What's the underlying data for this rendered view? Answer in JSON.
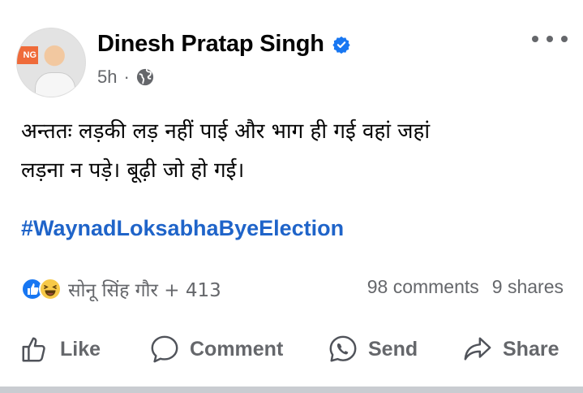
{
  "post": {
    "author": "Dinesh Pratap Singh",
    "time": "5h",
    "separator": "·",
    "avatar_flag_text": "NG",
    "body_lines": [
      "अन्ततः लड़की लड़ नहीं पाई और भाग ही गई वहां जहां",
      "लड़ना न पड़े। बूढ़ी जो हो गई।"
    ],
    "hashtag": "#WaynadLoksabhaByeElection"
  },
  "reactions": {
    "names": "सोनू सिंह गौर + 413",
    "comments": "98 comments",
    "shares": "9 shares"
  },
  "actions": {
    "like": "Like",
    "comment": "Comment",
    "send": "Send",
    "share": "Share"
  },
  "colors": {
    "brand_blue": "#1877f2",
    "hashtag": "#1f64c9",
    "muted": "#65676b"
  },
  "icons": [
    "verified-badge-icon",
    "globe-icon",
    "more-options-icon",
    "like-reaction-icon",
    "haha-reaction-icon",
    "like-icon",
    "comment-icon",
    "send-icon",
    "share-icon"
  ]
}
